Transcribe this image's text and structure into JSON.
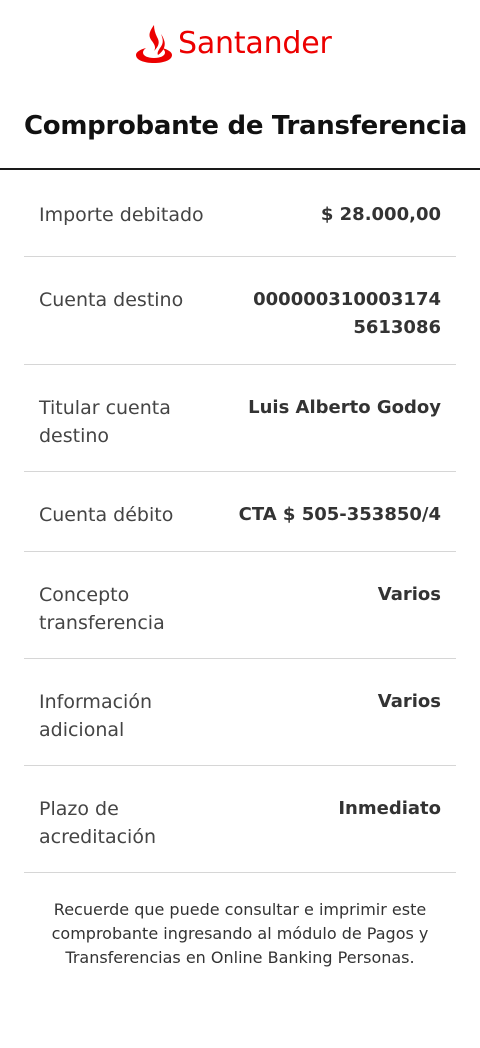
{
  "brand": {
    "name": "Santander",
    "color": "#ec0000",
    "icon": "santander-flame-icon"
  },
  "page": {
    "title": "Comprobante de Transferencia"
  },
  "details": [
    {
      "label": "Importe debitado",
      "value": "$ 28.000,00"
    },
    {
      "label": "Cuenta destino",
      "value": "0000003100031745613086"
    },
    {
      "label": "Titular cuenta destino",
      "value": "Luis Alberto Godoy"
    },
    {
      "label": "Cuenta débito",
      "value": "CTA $ 505-353850/4"
    },
    {
      "label": "Concepto transferencia",
      "value": "Varios"
    },
    {
      "label": "Información adicional",
      "value": "Varios"
    },
    {
      "label": "Plazo de acreditación",
      "value": "Inmediato"
    }
  ],
  "footer": {
    "note": "Recuerde que puede consultar e imprimir este comprobante ingresando al módulo de Pagos y Transferencias en Online Banking Personas."
  }
}
